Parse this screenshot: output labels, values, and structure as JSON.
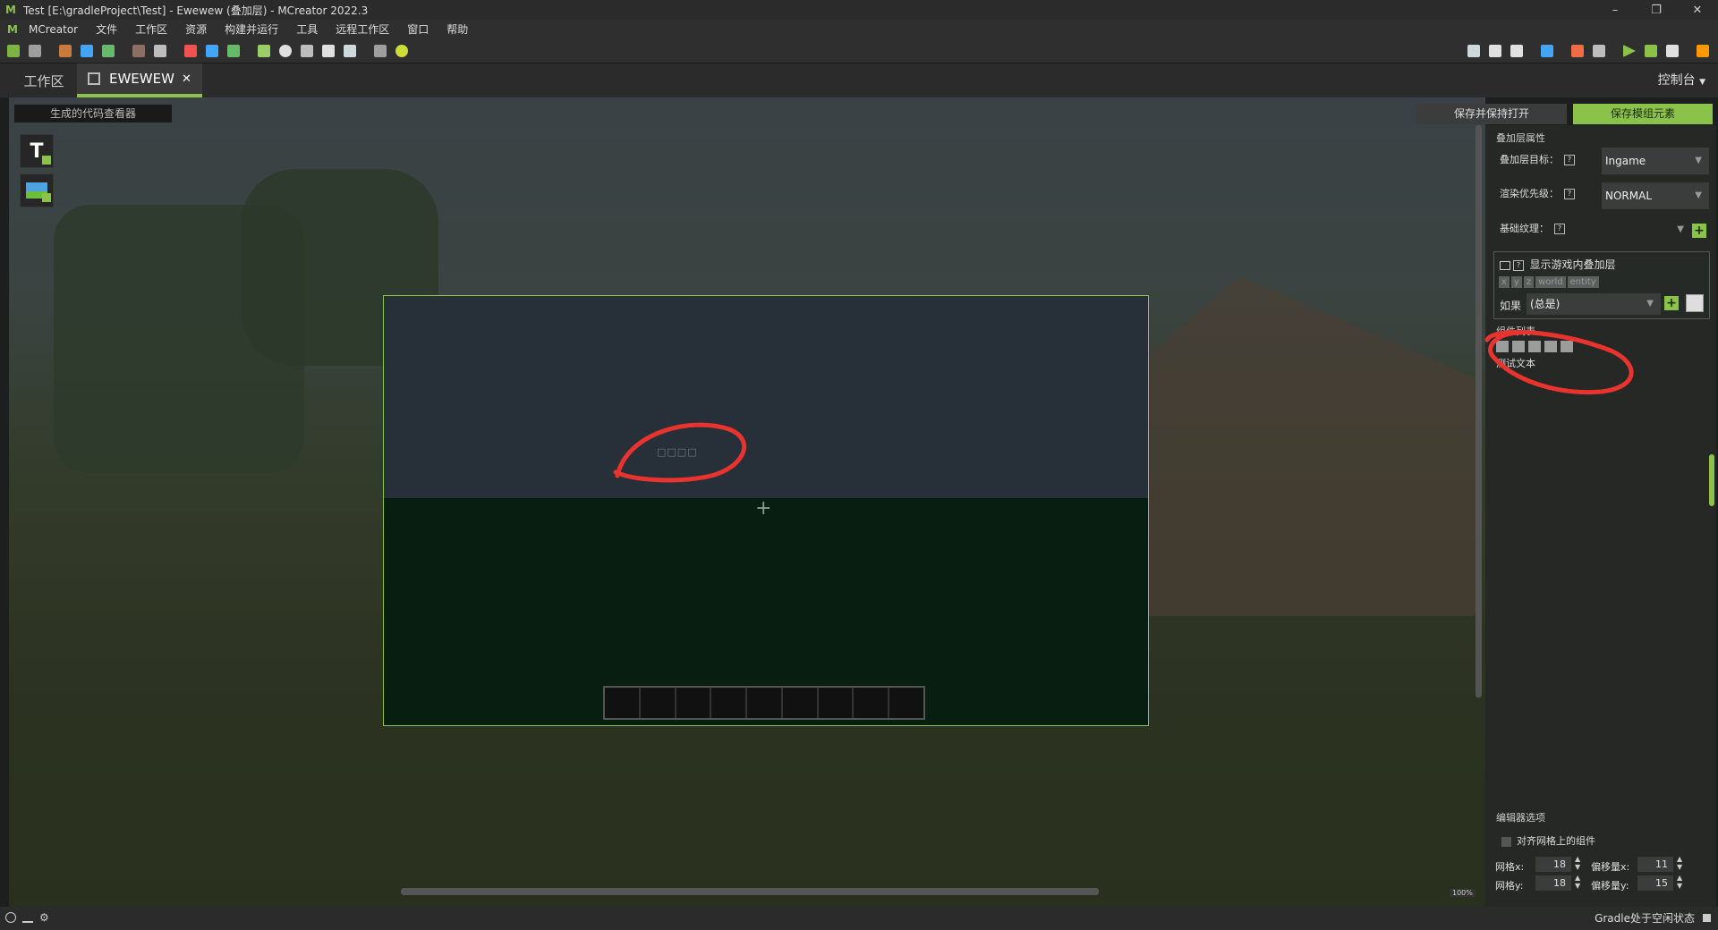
{
  "window": {
    "title": "Test [E:\\gradleProject\\Test] - Ewewew (叠加层) - MCreator 2022.3",
    "minimize": "–",
    "maximize": "❐",
    "close": "✕"
  },
  "menu": {
    "items": [
      "MCreator",
      "文件",
      "工作区",
      "资源",
      "构建并运行",
      "工具",
      "远程工作区",
      "窗口",
      "帮助"
    ]
  },
  "tabs": {
    "workspace": "工作区",
    "editor": "EWEWEW",
    "close": "✕",
    "console": "控制台"
  },
  "editor": {
    "code_viewer": "生成的代码查看器",
    "save_keep_open": "保存并保持打开",
    "save_element": "保存模组元素",
    "canvas_label": "□□□□",
    "crosshair": "+",
    "zoom": "100%"
  },
  "panel": {
    "overlay_props": "叠加层属性",
    "target_label": "叠加层目标：",
    "target_value": "Ingame",
    "priority_label": "渲染优先级：",
    "priority_value": "NORMAL",
    "base_texture_label": "基础纹理：",
    "help": "?",
    "show_ingame": "显示游戏内叠加层",
    "chips": [
      "x",
      "y",
      "z",
      "world",
      "entity"
    ],
    "if_label": "如果",
    "if_value": "(总是)",
    "component_list": "组件列表",
    "component_item": "测试文本",
    "editor_options": "编辑器选项",
    "snap_grid": "对齐网格上的组件",
    "grid_x_label": "网格x:",
    "grid_x": "18",
    "grid_y_label": "网格y:",
    "grid_y": "18",
    "offset_x_label": "偏移量x:",
    "offset_x": "11",
    "offset_y_label": "偏移量y:",
    "offset_y": "15"
  },
  "status": {
    "gradle": "Gradle处于空闲状态"
  },
  "colors": {
    "accent": "#8bc34a",
    "annotation": "#e8332f"
  }
}
